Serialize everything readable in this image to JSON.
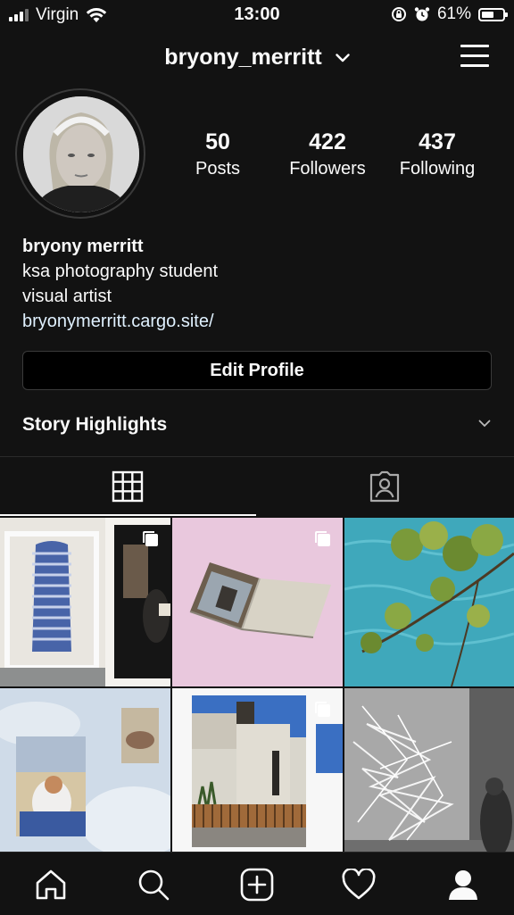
{
  "status_bar": {
    "carrier": "Virgin",
    "time": "13:00",
    "battery": "61%",
    "battery_level": 0.61
  },
  "header": {
    "username": "bryony_merritt"
  },
  "stats": [
    {
      "value": "50",
      "label": "Posts"
    },
    {
      "value": "422",
      "label": "Followers"
    },
    {
      "value": "437",
      "label": "Following"
    }
  ],
  "bio": {
    "name": "bryony merritt",
    "line1": "ksa photography student",
    "line2": "visual artist",
    "link": "bryonymerritt.cargo.site/"
  },
  "edit_profile_label": "Edit Profile",
  "story_highlights_label": "Story Highlights",
  "tabs": [
    {
      "name": "grid",
      "icon": "grid-icon",
      "active": true
    },
    {
      "name": "tagged",
      "icon": "tagged-person-icon",
      "active": false
    }
  ],
  "posts": [
    {
      "subject": "blue striped top in frame and interior photo",
      "multi": true
    },
    {
      "subject": "open photo book on pink background",
      "multi": true
    },
    {
      "subject": "tree branches over turquoise water",
      "multi": false
    },
    {
      "subject": "beach collage on sky",
      "multi": false
    },
    {
      "subject": "white building with wooden fence",
      "multi": true
    },
    {
      "subject": "light scribble drawing in gallery",
      "multi": false
    }
  ],
  "bottom_nav": [
    "home-icon",
    "search-icon",
    "new-post-icon",
    "activity-heart-icon",
    "profile-icon"
  ],
  "colors": {
    "background": "#121212",
    "text": "#fafafa",
    "link": "#e0f1ff",
    "border": "#3a3a3a"
  }
}
